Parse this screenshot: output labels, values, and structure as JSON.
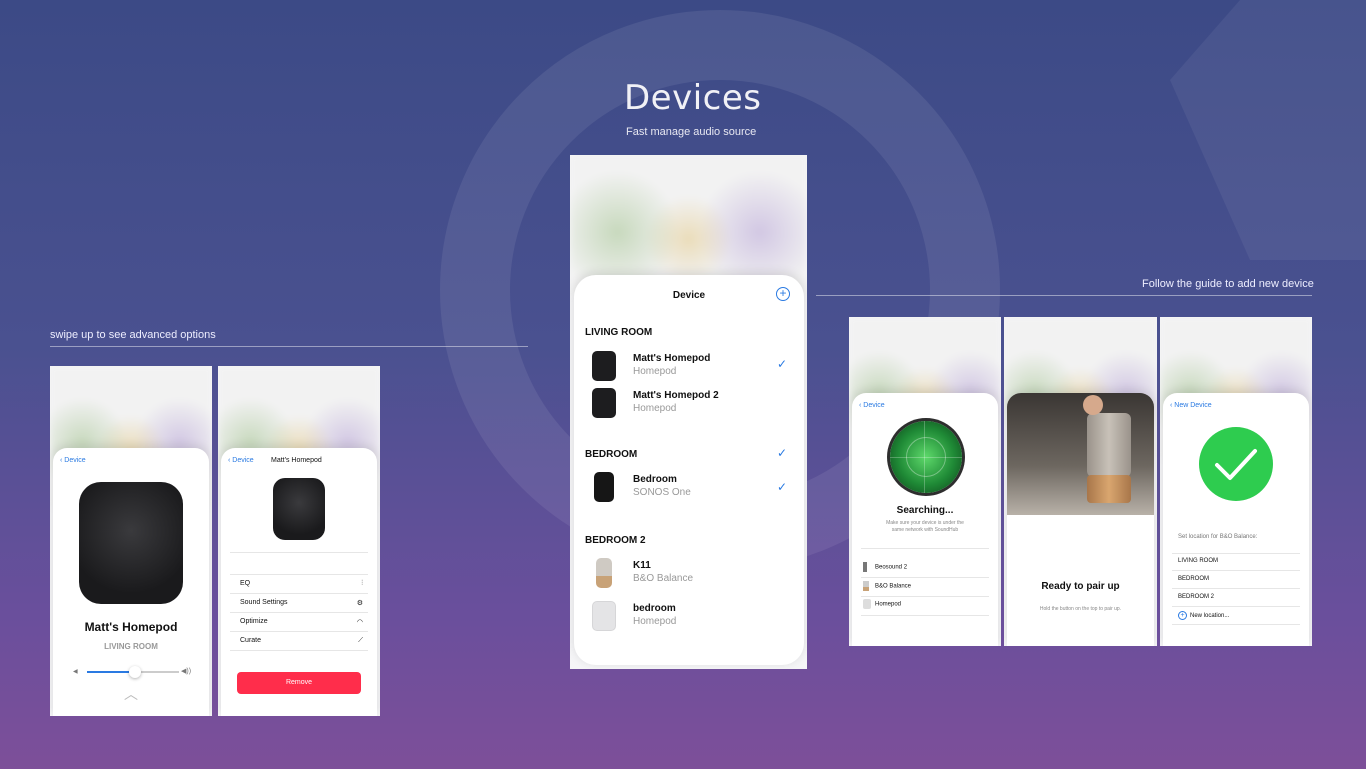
{
  "header": {
    "title": "Devices",
    "subtitle": "Fast manage audio source"
  },
  "captions": {
    "left": "swipe up to see advanced options",
    "right": "Follow the guide to add new device"
  },
  "main_list": {
    "title": "Device",
    "rooms": [
      {
        "name": "LIVING ROOM",
        "devices": [
          {
            "name": "Matt's Homepod",
            "type": "Homepod",
            "checked": true
          },
          {
            "name": "Matt's Homepod 2",
            "type": "Homepod",
            "checked": false
          }
        ]
      },
      {
        "name": "BEDROOM",
        "checked": true,
        "devices": [
          {
            "name": "Bedroom",
            "type": "SONOS One",
            "checked": true
          }
        ]
      },
      {
        "name": "BEDROOM 2",
        "devices": [
          {
            "name": "K11",
            "type": "B&O Balance",
            "checked": false
          },
          {
            "name": "bedroom",
            "type": "Homepod",
            "checked": false
          }
        ]
      }
    ]
  },
  "screen_detail": {
    "back_label": "Device",
    "device_name": "Matt's Homepod",
    "room": "LIVING ROOM"
  },
  "screen_settings": {
    "back_label": "Device",
    "title": "Matt's Homepod",
    "items": [
      "EQ",
      "Sound Settings",
      "Optimize",
      "Curate"
    ],
    "remove_label": "Remove"
  },
  "screen_search": {
    "back_label": "Device",
    "title": "Searching...",
    "hint": "Make sure your device is under the same network with SoundHub",
    "found": [
      "Beosound 2",
      "B&O Balance",
      "Homepod"
    ]
  },
  "screen_pair": {
    "title": "Ready to pair up",
    "hint": "Hold the button on the top to pair up."
  },
  "screen_location": {
    "back_label": "New Device",
    "prompt": "Set location for B&O Balance:",
    "locations": [
      "LIVING ROOM",
      "BEDROOM",
      "BEDROOM 2"
    ],
    "new_location": "New location..."
  },
  "colors": {
    "accent": "#2a7ae2",
    "remove": "#ff2d4b",
    "success": "#2ecc4f"
  }
}
